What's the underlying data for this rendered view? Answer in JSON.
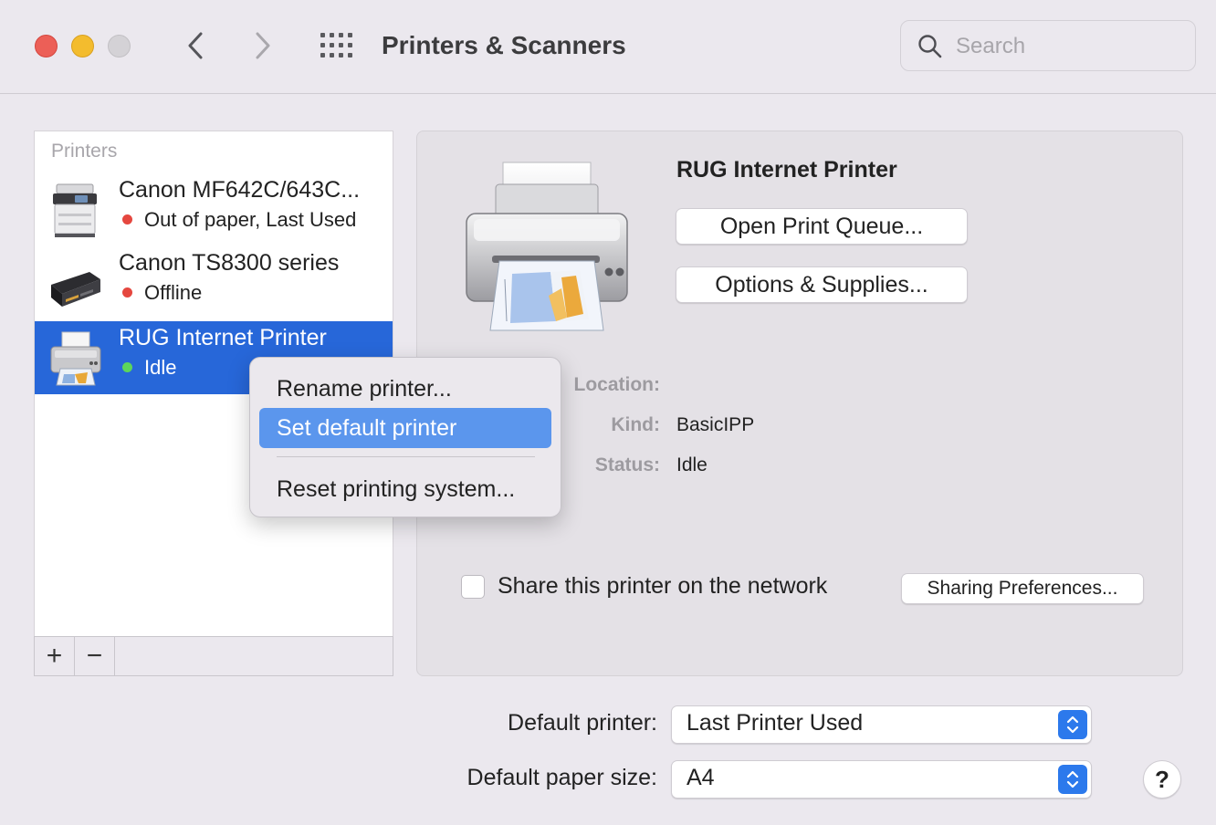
{
  "window": {
    "title": "Printers & Scanners"
  },
  "toolbar": {
    "back_icon": "chevron-left-icon",
    "forward_icon": "chevron-right-icon",
    "show_all_icon": "grid-icon"
  },
  "search": {
    "placeholder": "Search",
    "value": ""
  },
  "printer_list": {
    "header": "Printers",
    "items": [
      {
        "name": "Canon MF642C/643C...",
        "status": "Out of paper, Last Used",
        "status_color": "#e5473f",
        "selected": false,
        "icon": "multifunction-printer-icon"
      },
      {
        "name": "Canon TS8300 series",
        "status": "Offline",
        "status_color": "#e5473f",
        "selected": false,
        "icon": "inkjet-printer-icon"
      },
      {
        "name": "RUG Internet Printer",
        "status": "Idle",
        "status_color": "#5cd65b",
        "selected": true,
        "icon": "generic-printer-icon"
      }
    ],
    "add_label": "+",
    "remove_label": "−"
  },
  "context_menu": {
    "items": [
      {
        "label": "Rename printer..."
      },
      {
        "label": "Set default printer",
        "highlighted": true
      },
      {
        "label": "Reset printing system..."
      }
    ]
  },
  "detail": {
    "title": "RUG Internet Printer",
    "open_queue_label": "Open Print Queue...",
    "options_label": "Options & Supplies...",
    "location_label": "Location:",
    "location_value": "",
    "kind_label": "Kind:",
    "kind_value": "BasicIPP",
    "status_label": "Status:",
    "status_value": "Idle",
    "share_label": "Share this printer on the network",
    "share_checked": false,
    "sharing_prefs_label": "Sharing Preferences..."
  },
  "settings": {
    "default_printer_label": "Default printer:",
    "default_printer_value": "Last Printer Used",
    "default_paper_label": "Default paper size:",
    "default_paper_value": "A4"
  },
  "help_label": "?",
  "colors": {
    "selection_blue": "#2767d9",
    "menu_highlight": "#5b96ed",
    "stepper_blue": "#2c79ec",
    "close_red": "#ec5f57",
    "minimize_yellow": "#f3bc2e"
  }
}
